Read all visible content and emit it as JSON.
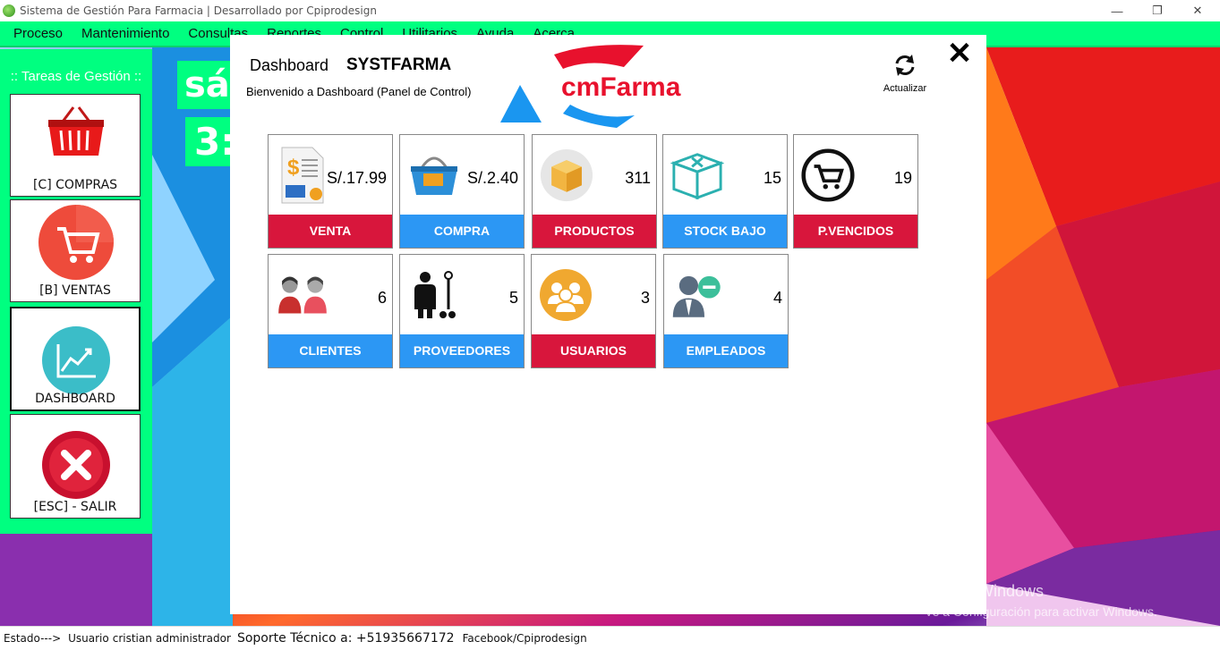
{
  "window": {
    "title": "Sistema de Gestión Para Farmacia | Desarrollado por Cpiprodesign",
    "minimize": "—",
    "maximize": "❐",
    "close": "✕"
  },
  "menu": [
    "Proceso",
    "Mantenimiento",
    "Consultas",
    "Reportes",
    "Control",
    "Utilitarios",
    "Ayuda",
    "Acerca"
  ],
  "sidebar": {
    "title": ":: Tareas de Gestión ::",
    "tiles": [
      {
        "label": "[C] COMPRAS",
        "icon": "shopping-basket-icon"
      },
      {
        "label": "[B] VENTAS",
        "icon": "shopping-cart-icon"
      },
      {
        "label": "DASHBOARD",
        "icon": "chart-trend-icon"
      },
      {
        "label": "[ESC] - SALIR",
        "icon": "close-circle-icon"
      }
    ]
  },
  "background_text": {
    "line1": "sá",
    "line2": "3:"
  },
  "dashboard": {
    "title": "Dashboard",
    "brand": "SYSTFARMA",
    "welcome": "Bienvenido a Dashboard (Panel de Control)",
    "logo_text": "cmFarma",
    "refresh_label": "Actualizar",
    "close": "✕",
    "cards": [
      {
        "label": "VENTA",
        "value": "S/.17.99",
        "color": "#d8163c",
        "icon": "invoice-icon"
      },
      {
        "label": "COMPRA",
        "value": "S/.2.40",
        "color": "#2c97f4",
        "icon": "basket-icon"
      },
      {
        "label": "PRODUCTOS",
        "value": "311",
        "color": "#d8163c",
        "icon": "box-icon"
      },
      {
        "label": "STOCK BAJO",
        "value": "15",
        "color": "#2c97f4",
        "icon": "empty-box-icon"
      },
      {
        "label": "P.VENCIDOS",
        "value": "19",
        "color": "#d8163c",
        "icon": "cart-circle-icon"
      },
      {
        "label": "CLIENTES",
        "value": "6",
        "color": "#2c97f4",
        "icon": "clients-icon"
      },
      {
        "label": "PROVEEDORES",
        "value": "5",
        "color": "#2c97f4",
        "icon": "supplier-icon"
      },
      {
        "label": "USUARIOS",
        "value": "3",
        "color": "#d8163c",
        "icon": "users-icon"
      },
      {
        "label": "EMPLEADOS",
        "value": "4",
        "color": "#2c97f4",
        "icon": "employees-icon"
      }
    ]
  },
  "status": {
    "estado": "Estado--->",
    "usuario_label": "Usuario",
    "usuario_name": "cristian",
    "usuario_role": "administrador",
    "soporte": "Soporte Técnico a: +51935667172",
    "facebook": "Facebook/Cpiprodesign"
  },
  "watermark": {
    "line1": "Activar Windows",
    "line2": "Ve a Configuración para activar Windows."
  }
}
